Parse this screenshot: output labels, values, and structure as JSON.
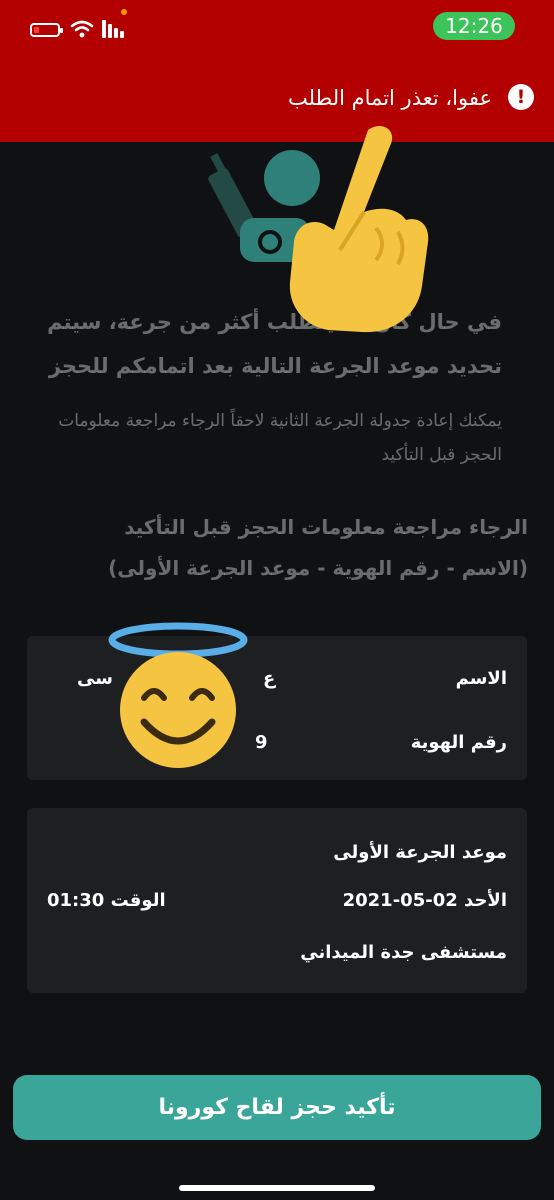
{
  "status_bar": {
    "time": "12:26"
  },
  "banner": {
    "message": "عفوا، تعذر اتمام الطلب",
    "icon": "exclamation-icon",
    "icon_glyph": "!"
  },
  "intro": {
    "title_line1": "في حال كان ... يتطلب أكثر من جرعة، سيتم",
    "title_line2": "تحديد موعد الجرعة التالية بعد اتمامكم للحجز",
    "subtitle_line1": "يمكنك إعادة جدولة الجرعة الثانية لاحقاً الرجاء مراجعة معلومات",
    "subtitle_line2": "الحجز قبل التأكيد"
  },
  "review": {
    "title_line1": "الرجاء مراجعة معلومات الحجز قبل التأكيد",
    "title_line2": "(الاسم - رقم الهوية - موعد الجرعة الأولى)"
  },
  "personal_card": {
    "name_label": "الاسم",
    "name_value_left": "سى",
    "name_value_right": "ع",
    "id_label": "رقم الهوية",
    "id_value": "9"
  },
  "dose_card": {
    "heading": "موعد الجرعة الأولى",
    "date": "الأحد 02-05-2021",
    "time_label": "الوقت",
    "time_value": "01:30",
    "location": "مستشفى جدة الميداني"
  },
  "confirm_button": {
    "label": "تأكيد حجز لقاح كورونا"
  },
  "colors": {
    "banner": "#b30000",
    "background": "#0f1113",
    "card": "#1d1f21",
    "button": "#3aa69a",
    "time_pill": "#3cc35a"
  },
  "overlays": [
    "pointing-hand-emoji",
    "smiling-face-with-halo-emoji"
  ]
}
